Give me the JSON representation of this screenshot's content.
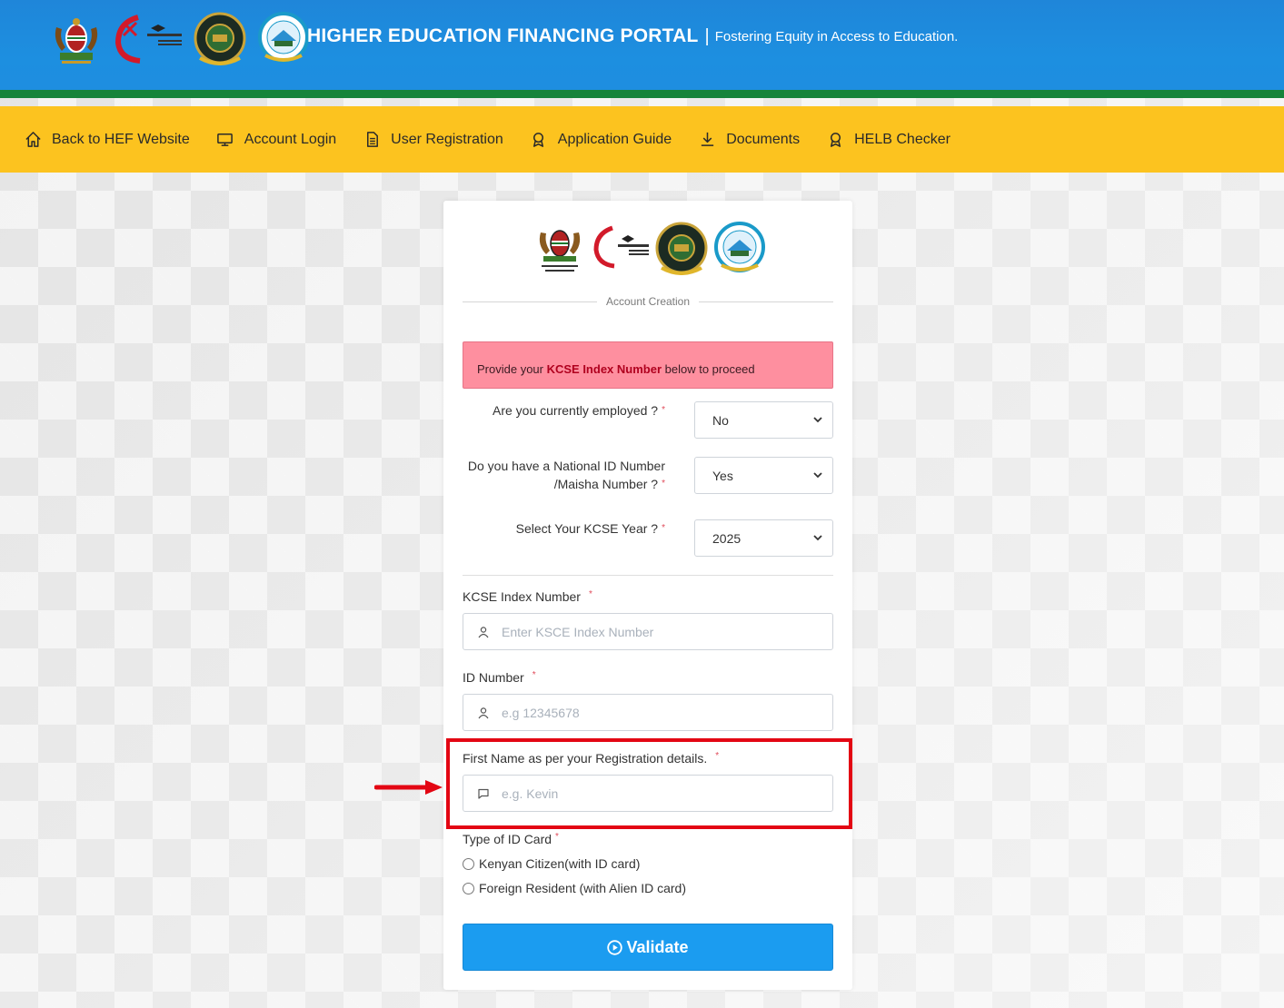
{
  "header": {
    "title": "HIGHER EDUCATION FINANCING PORTAL",
    "separator": "|",
    "tagline": "Fostering Equity in Access to Education.",
    "logos": [
      "kenya-coat-of-arms",
      "ministry-of-education-logo",
      "helb-logo",
      "universities-fund-logo"
    ],
    "brand_color": "#1e8de0",
    "strip_color": "#16843a"
  },
  "nav": {
    "bg_color": "#fcc31f",
    "items": [
      {
        "label": "Back to HEF Website",
        "icon": "home-icon"
      },
      {
        "label": "Account Login",
        "icon": "monitor-icon"
      },
      {
        "label": "User Registration",
        "icon": "document-icon"
      },
      {
        "label": "Application Guide",
        "icon": "award-icon"
      },
      {
        "label": "Documents",
        "icon": "download-icon"
      },
      {
        "label": "HELB Checker",
        "icon": "award-icon"
      }
    ]
  },
  "card": {
    "logos": [
      "kenya-coat-of-arms",
      "ministry-of-education-logo",
      "helb-logo",
      "universities-fund-logo"
    ],
    "section_title": "Account Creation",
    "alert": {
      "prefix": "Provide your ",
      "bold": "KCSE Index Number",
      "suffix": " below to proceed",
      "bg_color": "#fe8f9f"
    },
    "questions": [
      {
        "label": "Are you currently employed ?",
        "required": "*",
        "value": "No"
      },
      {
        "label": "Do you have a National ID Number /Maisha Number ?",
        "required": "*",
        "value": "Yes"
      },
      {
        "label": "Select Your KCSE Year ?",
        "required": "*",
        "value": "2025"
      }
    ],
    "fields": {
      "kcse_index": {
        "label": "KCSE Index Number",
        "required": "*",
        "placeholder": "Enter KSCE Index Number",
        "icon": "user-icon"
      },
      "id_number": {
        "label": "ID Number",
        "required": "*",
        "placeholder": "e.g 12345678",
        "icon": "user-icon"
      },
      "first_name": {
        "label": "First Name as per your Registration details.",
        "required": "*",
        "placeholder": "e.g. Kevin",
        "icon": "message-icon"
      }
    },
    "id_card": {
      "label": "Type of ID Card",
      "required": "*",
      "options": [
        "Kenyan Citizen(with ID card)",
        "Foreign Resident (with Alien ID card)"
      ]
    },
    "validate_label": "Validate",
    "validate_color": "#1b9cf0"
  },
  "annotation": {
    "highlight_color": "#e30613"
  }
}
